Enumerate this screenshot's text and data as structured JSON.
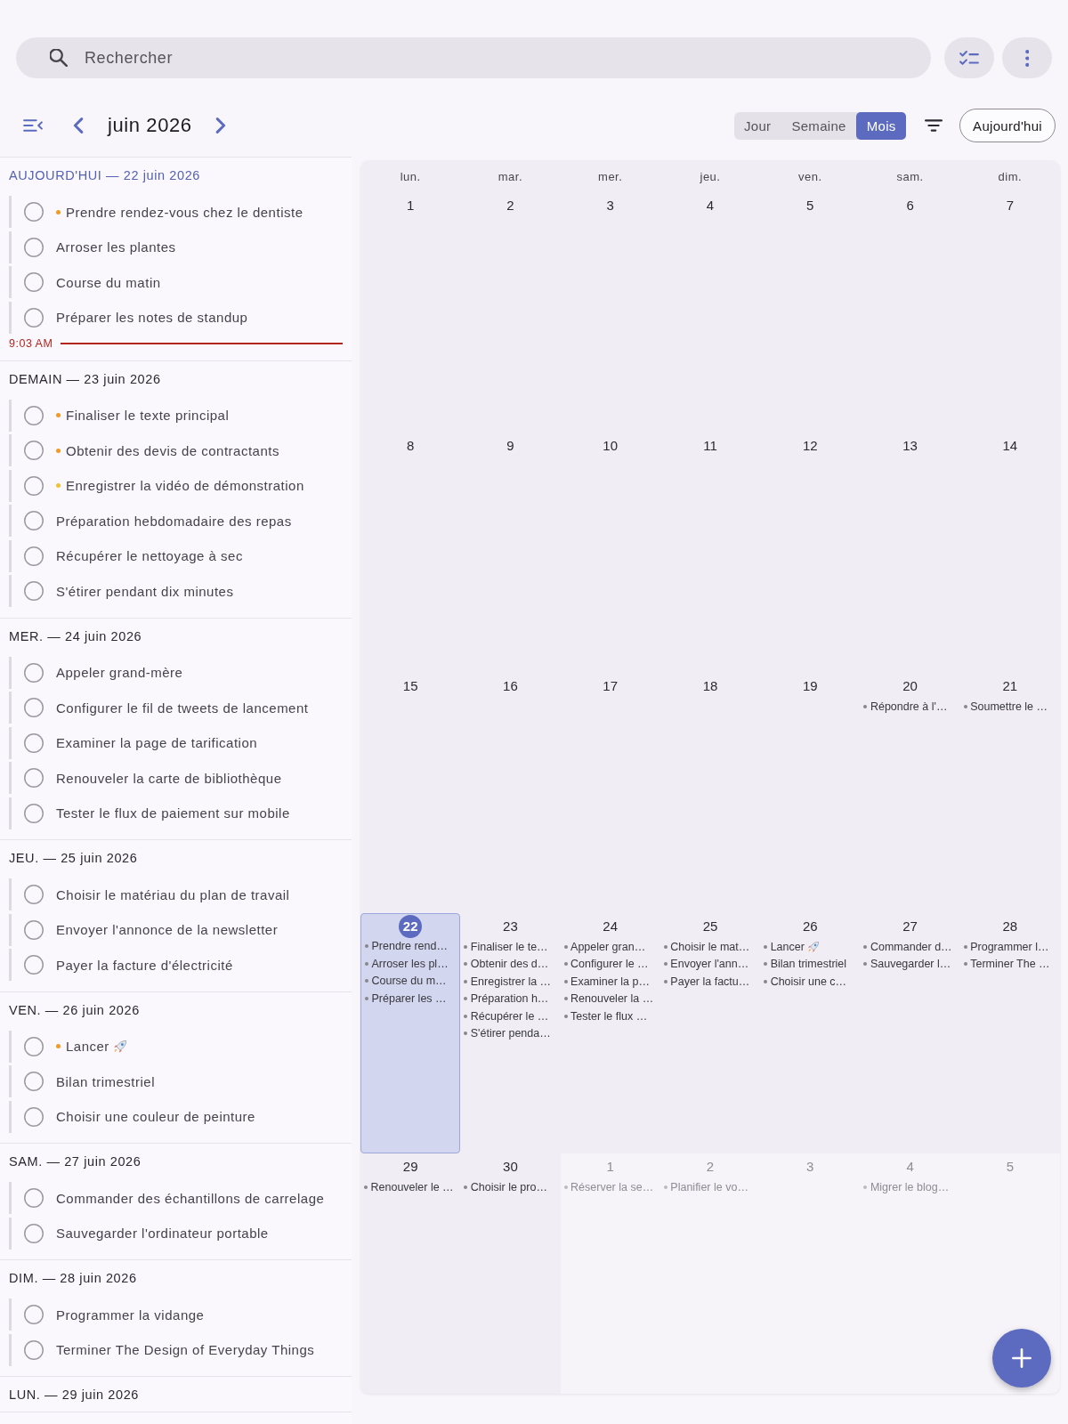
{
  "search": {
    "placeholder": "Rechercher"
  },
  "toolbar": {
    "month_label": "juin 2026",
    "views": [
      {
        "label": "Jour",
        "selected": false
      },
      {
        "label": "Semaine",
        "selected": false
      },
      {
        "label": "Mois",
        "selected": true
      }
    ],
    "today_button": "Aujourd'hui"
  },
  "agenda": {
    "sections": [
      {
        "title": "AUJOURD'HUI — 22 juin 2026",
        "today": true,
        "now_marker": "9:03 AM",
        "tasks": [
          {
            "title": "Prendre rendez-vous chez le dentiste",
            "checked": false,
            "color": "#f39a21"
          },
          {
            "title": "Arroser les plantes",
            "checked": false
          },
          {
            "title": "Course du matin",
            "checked": false
          },
          {
            "title": "Préparer les notes de standup",
            "checked": false
          }
        ]
      },
      {
        "title": "DEMAIN — 23 juin 2026",
        "today": false,
        "tasks": [
          {
            "title": "Finaliser le texte principal",
            "checked": false,
            "color": "#f39a21"
          },
          {
            "title": "Obtenir des devis de contractants",
            "checked": false,
            "color": "#f39a21"
          },
          {
            "title": "Enregistrer la vidéo de démonstration",
            "checked": false,
            "color": "#f2c230"
          },
          {
            "title": "Préparation hebdomadaire des repas",
            "checked": false
          },
          {
            "title": "Récupérer le nettoyage à sec",
            "checked": false
          },
          {
            "title": "S'étirer pendant dix minutes",
            "checked": false
          }
        ]
      },
      {
        "title": "MER. — 24 juin 2026",
        "today": false,
        "tasks": [
          {
            "title": "Appeler grand-mère",
            "checked": false
          },
          {
            "title": "Configurer le fil de tweets de lancement",
            "checked": false
          },
          {
            "title": "Examiner la page de tarification",
            "checked": false
          },
          {
            "title": "Renouveler la carte de bibliothèque",
            "checked": false
          },
          {
            "title": "Tester le flux de paiement sur mobile",
            "checked": false
          }
        ]
      },
      {
        "title": "JEU. — 25 juin 2026",
        "today": false,
        "tasks": [
          {
            "title": "Choisir le matériau du plan de travail",
            "checked": false
          },
          {
            "title": "Envoyer l'annonce de la newsletter",
            "checked": false
          },
          {
            "title": "Payer la facture d'électricité",
            "checked": false
          }
        ]
      },
      {
        "title": "VEN. — 26 juin 2026",
        "today": false,
        "tasks": [
          {
            "title": "Lancer",
            "checked": false,
            "color": "#f39a21",
            "trailing_icon": true
          },
          {
            "title": "Bilan trimestriel",
            "checked": false
          },
          {
            "title": "Choisir une couleur de peinture",
            "checked": false
          }
        ]
      },
      {
        "title": "SAM. — 27 juin 2026",
        "today": false,
        "tasks": [
          {
            "title": "Commander des échantillons de carrelage",
            "checked": false
          },
          {
            "title": "Sauvegarder l'ordinateur portable",
            "checked": false
          }
        ]
      },
      {
        "title": "DIM. — 28 juin 2026",
        "today": false,
        "tasks": [
          {
            "title": "Programmer la vidange",
            "checked": false
          },
          {
            "title": "Terminer The Design of Everyday Things",
            "checked": false
          }
        ]
      },
      {
        "title": "LUN. — 29 juin 2026",
        "today": false
      }
    ]
  },
  "calendar": {
    "weekdays": [
      "lun.",
      "mar.",
      "mer.",
      "jeu.",
      "ven.",
      "sam.",
      "dim."
    ],
    "weeks": [
      {
        "days": [
          {
            "number": "1",
            "selected": false,
            "other_month": false
          },
          {
            "number": "2",
            "selected": false,
            "other_month": false
          },
          {
            "number": "3",
            "selected": false,
            "other_month": false
          },
          {
            "number": "4",
            "selected": false,
            "other_month": false
          },
          {
            "number": "5",
            "selected": false,
            "other_month": false
          },
          {
            "number": "6",
            "selected": false,
            "other_month": false
          },
          {
            "number": "7",
            "selected": false,
            "other_month": false
          }
        ]
      },
      {
        "days": [
          {
            "number": "8",
            "selected": false,
            "other_month": false
          },
          {
            "number": "9",
            "selected": false,
            "other_month": false
          },
          {
            "number": "10",
            "selected": false,
            "other_month": false
          },
          {
            "number": "11",
            "selected": false,
            "other_month": false
          },
          {
            "number": "12",
            "selected": false,
            "other_month": false
          },
          {
            "number": "13",
            "selected": false,
            "other_month": false
          },
          {
            "number": "14",
            "selected": false,
            "other_month": false
          }
        ]
      },
      {
        "days": [
          {
            "number": "15",
            "selected": false,
            "other_month": false
          },
          {
            "number": "16",
            "selected": false,
            "other_month": false
          },
          {
            "number": "17",
            "selected": false,
            "other_month": false
          },
          {
            "number": "18",
            "selected": false,
            "other_month": false
          },
          {
            "number": "19",
            "selected": false,
            "other_month": false
          },
          {
            "number": "20",
            "selected": false,
            "other_month": false,
            "events": [
              {
                "title": "Répondre à l'…"
              }
            ]
          },
          {
            "number": "21",
            "selected": false,
            "other_month": false,
            "events": [
              {
                "title": "Soumettre le …"
              }
            ]
          }
        ]
      },
      {
        "days": [
          {
            "number": "22",
            "selected": true,
            "other_month": false,
            "events": [
              {
                "title": "Prendre rend…"
              },
              {
                "title": "Arroser les pl…"
              },
              {
                "title": "Course du m…"
              },
              {
                "title": "Préparer les …"
              }
            ]
          },
          {
            "number": "23",
            "selected": false,
            "other_month": false,
            "events": [
              {
                "title": "Finaliser le te…"
              },
              {
                "title": "Obtenir des d…"
              },
              {
                "title": "Enregistrer la …"
              },
              {
                "title": "Préparation h…"
              },
              {
                "title": "Récupérer le …"
              },
              {
                "title": "S'étirer penda…"
              }
            ]
          },
          {
            "number": "24",
            "selected": false,
            "other_month": false,
            "events": [
              {
                "title": "Appeler gran…"
              },
              {
                "title": "Configurer le …"
              },
              {
                "title": "Examiner la p…"
              },
              {
                "title": "Renouveler la …"
              },
              {
                "title": "Tester le flux …"
              }
            ]
          },
          {
            "number": "25",
            "selected": false,
            "other_month": false,
            "events": [
              {
                "title": "Choisir le mat…"
              },
              {
                "title": "Envoyer l'ann…"
              },
              {
                "title": "Payer la factu…"
              }
            ]
          },
          {
            "number": "26",
            "selected": false,
            "other_month": false,
            "events": [
              {
                "title": "Lancer",
                "trailing_icon": true
              },
              {
                "title": "Bilan trimestriel"
              },
              {
                "title": "Choisir une c…"
              }
            ]
          },
          {
            "number": "27",
            "selected": false,
            "other_month": false,
            "events": [
              {
                "title": "Commander d…"
              },
              {
                "title": "Sauvegarder l…"
              }
            ]
          },
          {
            "number": "28",
            "selected": false,
            "other_month": false,
            "events": [
              {
                "title": "Programmer l…"
              },
              {
                "title": "Terminer The …"
              }
            ]
          }
        ]
      },
      {
        "days": [
          {
            "number": "29",
            "selected": false,
            "other_month": false,
            "events": [
              {
                "title": "Renouveler le …"
              }
            ]
          },
          {
            "number": "30",
            "selected": false,
            "other_month": false,
            "events": [
              {
                "title": "Choisir le pro…"
              }
            ]
          },
          {
            "number": "1",
            "selected": false,
            "other_month": true,
            "events": [
              {
                "title": "Réserver la se…"
              }
            ]
          },
          {
            "number": "2",
            "selected": false,
            "other_month": true,
            "events": [
              {
                "title": "Planifier le vo…"
              }
            ]
          },
          {
            "number": "3",
            "selected": false,
            "other_month": true
          },
          {
            "number": "4",
            "selected": false,
            "other_month": true,
            "events": [
              {
                "title": "Migrer le blog…"
              }
            ]
          },
          {
            "number": "5",
            "selected": false,
            "other_month": true
          }
        ]
      }
    ]
  }
}
